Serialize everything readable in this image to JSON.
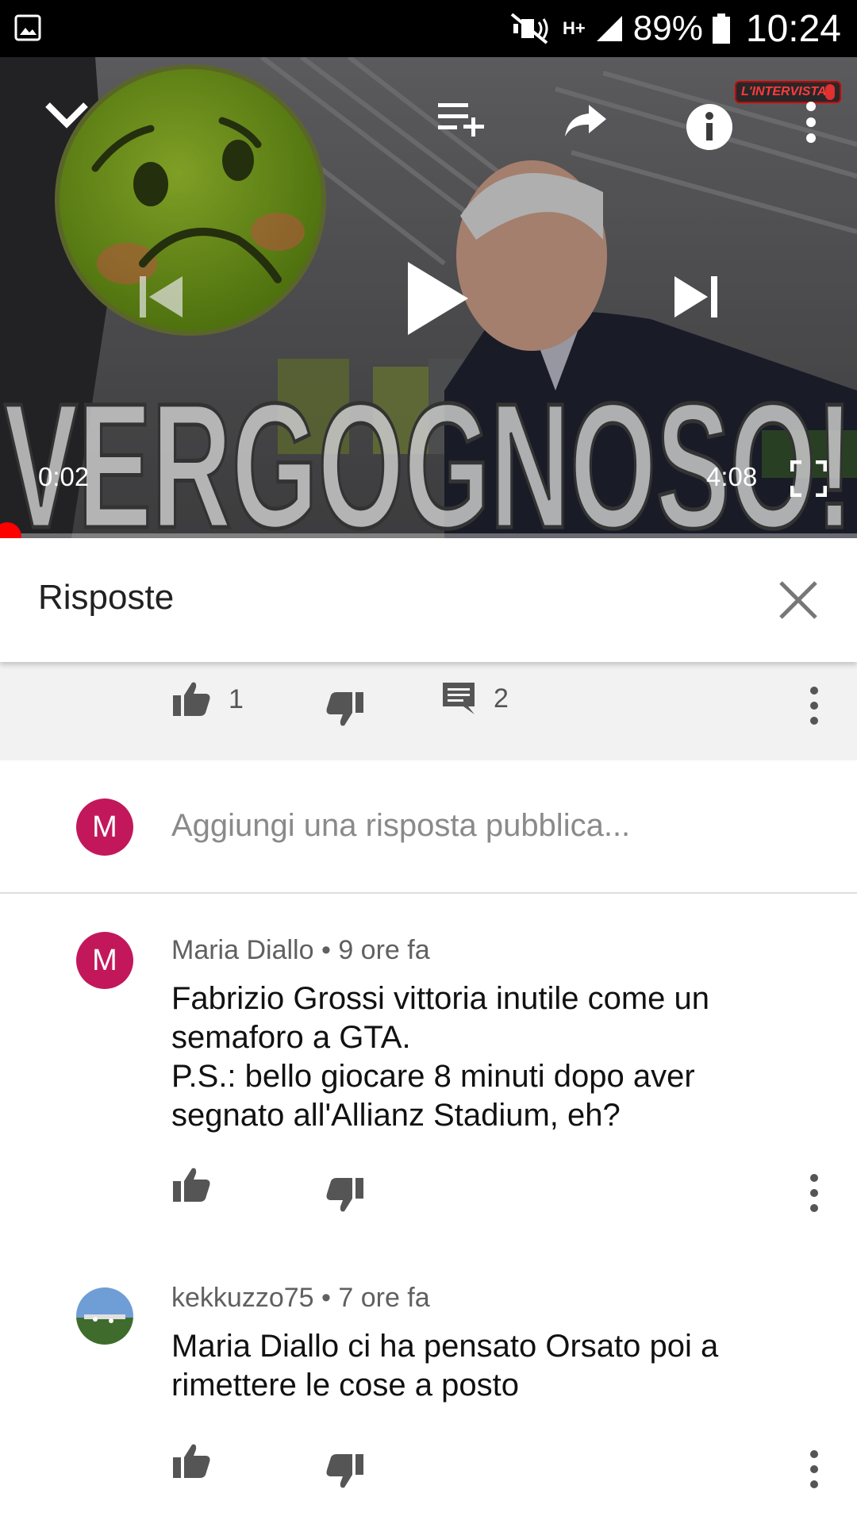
{
  "status_bar": {
    "network": "H+",
    "battery": "89%",
    "time": "10:24"
  },
  "player": {
    "current_time": "0:02",
    "duration": "4:08",
    "progress_fraction": 0.008,
    "overlay_title": "VERGOGNOSO!",
    "watermark": "L'INTERVISTA"
  },
  "replies_panel": {
    "title": "Risposte"
  },
  "parent_comment": {
    "likes": "1",
    "replies": "2"
  },
  "composer": {
    "avatar_letter": "M",
    "placeholder": "Aggiungi una risposta pubblica..."
  },
  "comments": [
    {
      "author": "Maria Diallo",
      "time": "9 ore fa",
      "avatar_letter": "M",
      "lines": [
        "Fabrizio Grossi vittoria inutile come un",
        "semaforo a GTA.",
        "P.S.: bello giocare 8 minuti dopo aver",
        "segnato all'Allianz Stadium, eh?"
      ]
    },
    {
      "author": "kekkuzzo75",
      "time": "7 ore fa",
      "lines": [
        "Maria Diallo ci ha pensato Orsato poi a",
        "rimettere le cose a posto"
      ]
    }
  ],
  "colors": {
    "accent": "#ff0000",
    "avatar_m": "#c2185b"
  }
}
